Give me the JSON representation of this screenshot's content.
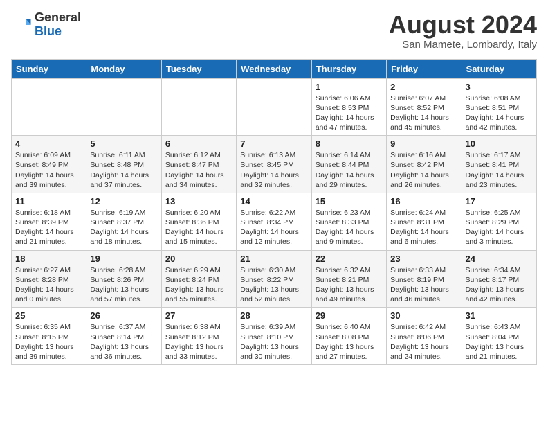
{
  "header": {
    "logo_general": "General",
    "logo_blue": "Blue",
    "month_title": "August 2024",
    "subtitle": "San Mamete, Lombardy, Italy"
  },
  "weekdays": [
    "Sunday",
    "Monday",
    "Tuesday",
    "Wednesday",
    "Thursday",
    "Friday",
    "Saturday"
  ],
  "weeks": [
    [
      {
        "day": "",
        "sunrise": "",
        "sunset": "",
        "daylight": ""
      },
      {
        "day": "",
        "sunrise": "",
        "sunset": "",
        "daylight": ""
      },
      {
        "day": "",
        "sunrise": "",
        "sunset": "",
        "daylight": ""
      },
      {
        "day": "",
        "sunrise": "",
        "sunset": "",
        "daylight": ""
      },
      {
        "day": "1",
        "sunrise": "Sunrise: 6:06 AM",
        "sunset": "Sunset: 8:53 PM",
        "daylight": "Daylight: 14 hours and 47 minutes."
      },
      {
        "day": "2",
        "sunrise": "Sunrise: 6:07 AM",
        "sunset": "Sunset: 8:52 PM",
        "daylight": "Daylight: 14 hours and 45 minutes."
      },
      {
        "day": "3",
        "sunrise": "Sunrise: 6:08 AM",
        "sunset": "Sunset: 8:51 PM",
        "daylight": "Daylight: 14 hours and 42 minutes."
      }
    ],
    [
      {
        "day": "4",
        "sunrise": "Sunrise: 6:09 AM",
        "sunset": "Sunset: 8:49 PM",
        "daylight": "Daylight: 14 hours and 39 minutes."
      },
      {
        "day": "5",
        "sunrise": "Sunrise: 6:11 AM",
        "sunset": "Sunset: 8:48 PM",
        "daylight": "Daylight: 14 hours and 37 minutes."
      },
      {
        "day": "6",
        "sunrise": "Sunrise: 6:12 AM",
        "sunset": "Sunset: 8:47 PM",
        "daylight": "Daylight: 14 hours and 34 minutes."
      },
      {
        "day": "7",
        "sunrise": "Sunrise: 6:13 AM",
        "sunset": "Sunset: 8:45 PM",
        "daylight": "Daylight: 14 hours and 32 minutes."
      },
      {
        "day": "8",
        "sunrise": "Sunrise: 6:14 AM",
        "sunset": "Sunset: 8:44 PM",
        "daylight": "Daylight: 14 hours and 29 minutes."
      },
      {
        "day": "9",
        "sunrise": "Sunrise: 6:16 AM",
        "sunset": "Sunset: 8:42 PM",
        "daylight": "Daylight: 14 hours and 26 minutes."
      },
      {
        "day": "10",
        "sunrise": "Sunrise: 6:17 AM",
        "sunset": "Sunset: 8:41 PM",
        "daylight": "Daylight: 14 hours and 23 minutes."
      }
    ],
    [
      {
        "day": "11",
        "sunrise": "Sunrise: 6:18 AM",
        "sunset": "Sunset: 8:39 PM",
        "daylight": "Daylight: 14 hours and 21 minutes."
      },
      {
        "day": "12",
        "sunrise": "Sunrise: 6:19 AM",
        "sunset": "Sunset: 8:37 PM",
        "daylight": "Daylight: 14 hours and 18 minutes."
      },
      {
        "day": "13",
        "sunrise": "Sunrise: 6:20 AM",
        "sunset": "Sunset: 8:36 PM",
        "daylight": "Daylight: 14 hours and 15 minutes."
      },
      {
        "day": "14",
        "sunrise": "Sunrise: 6:22 AM",
        "sunset": "Sunset: 8:34 PM",
        "daylight": "Daylight: 14 hours and 12 minutes."
      },
      {
        "day": "15",
        "sunrise": "Sunrise: 6:23 AM",
        "sunset": "Sunset: 8:33 PM",
        "daylight": "Daylight: 14 hours and 9 minutes."
      },
      {
        "day": "16",
        "sunrise": "Sunrise: 6:24 AM",
        "sunset": "Sunset: 8:31 PM",
        "daylight": "Daylight: 14 hours and 6 minutes."
      },
      {
        "day": "17",
        "sunrise": "Sunrise: 6:25 AM",
        "sunset": "Sunset: 8:29 PM",
        "daylight": "Daylight: 14 hours and 3 minutes."
      }
    ],
    [
      {
        "day": "18",
        "sunrise": "Sunrise: 6:27 AM",
        "sunset": "Sunset: 8:28 PM",
        "daylight": "Daylight: 14 hours and 0 minutes."
      },
      {
        "day": "19",
        "sunrise": "Sunrise: 6:28 AM",
        "sunset": "Sunset: 8:26 PM",
        "daylight": "Daylight: 13 hours and 57 minutes."
      },
      {
        "day": "20",
        "sunrise": "Sunrise: 6:29 AM",
        "sunset": "Sunset: 8:24 PM",
        "daylight": "Daylight: 13 hours and 55 minutes."
      },
      {
        "day": "21",
        "sunrise": "Sunrise: 6:30 AM",
        "sunset": "Sunset: 8:22 PM",
        "daylight": "Daylight: 13 hours and 52 minutes."
      },
      {
        "day": "22",
        "sunrise": "Sunrise: 6:32 AM",
        "sunset": "Sunset: 8:21 PM",
        "daylight": "Daylight: 13 hours and 49 minutes."
      },
      {
        "day": "23",
        "sunrise": "Sunrise: 6:33 AM",
        "sunset": "Sunset: 8:19 PM",
        "daylight": "Daylight: 13 hours and 46 minutes."
      },
      {
        "day": "24",
        "sunrise": "Sunrise: 6:34 AM",
        "sunset": "Sunset: 8:17 PM",
        "daylight": "Daylight: 13 hours and 42 minutes."
      }
    ],
    [
      {
        "day": "25",
        "sunrise": "Sunrise: 6:35 AM",
        "sunset": "Sunset: 8:15 PM",
        "daylight": "Daylight: 13 hours and 39 minutes."
      },
      {
        "day": "26",
        "sunrise": "Sunrise: 6:37 AM",
        "sunset": "Sunset: 8:14 PM",
        "daylight": "Daylight: 13 hours and 36 minutes."
      },
      {
        "day": "27",
        "sunrise": "Sunrise: 6:38 AM",
        "sunset": "Sunset: 8:12 PM",
        "daylight": "Daylight: 13 hours and 33 minutes."
      },
      {
        "day": "28",
        "sunrise": "Sunrise: 6:39 AM",
        "sunset": "Sunset: 8:10 PM",
        "daylight": "Daylight: 13 hours and 30 minutes."
      },
      {
        "day": "29",
        "sunrise": "Sunrise: 6:40 AM",
        "sunset": "Sunset: 8:08 PM",
        "daylight": "Daylight: 13 hours and 27 minutes."
      },
      {
        "day": "30",
        "sunrise": "Sunrise: 6:42 AM",
        "sunset": "Sunset: 8:06 PM",
        "daylight": "Daylight: 13 hours and 24 minutes."
      },
      {
        "day": "31",
        "sunrise": "Sunrise: 6:43 AM",
        "sunset": "Sunset: 8:04 PM",
        "daylight": "Daylight: 13 hours and 21 minutes."
      }
    ]
  ]
}
